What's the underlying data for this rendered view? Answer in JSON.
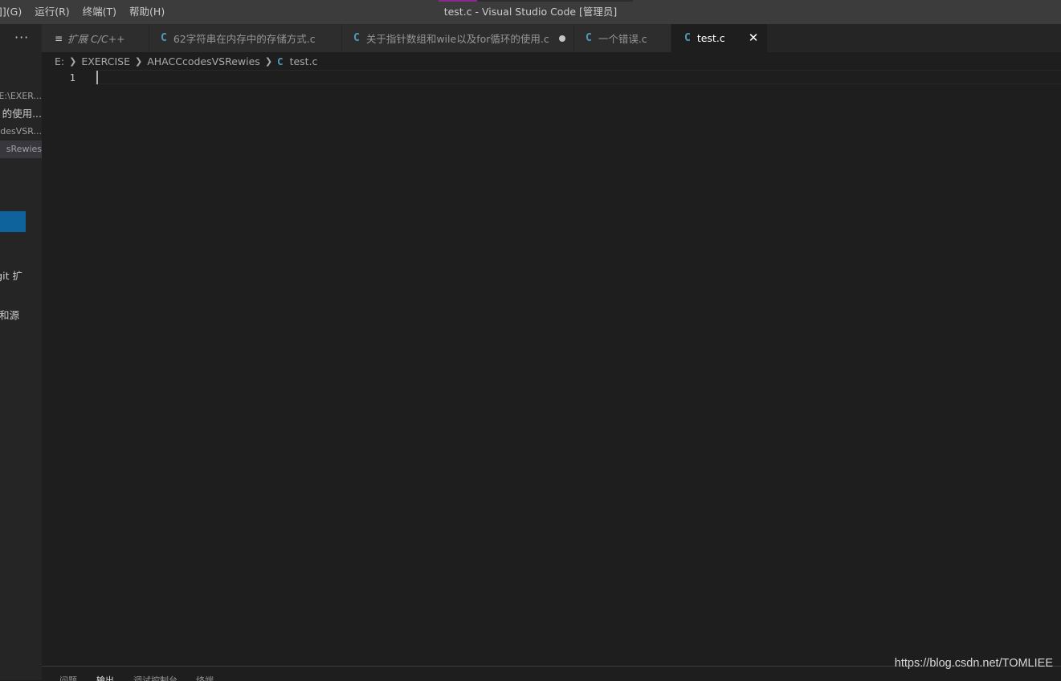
{
  "menu": {
    "items": [
      "]](G)",
      "运行(R)",
      "终端(T)",
      "帮助(H)"
    ]
  },
  "window": {
    "title": "test.c - Visual Studio Code [管理员]"
  },
  "sidebar": {
    "more_label": "···",
    "rows": [
      "E:\\EXER...",
      "的使用...",
      "odesVSR...",
      "sRewies"
    ],
    "texts": [
      "git 扩",
      "和源"
    ]
  },
  "tabs": [
    {
      "icon": "markdown-preview-icon",
      "label": "扩展 C/C++",
      "italic": true
    },
    {
      "icon": "c-file-icon",
      "label": "62字符串在内存中的存储方式.c"
    },
    {
      "icon": "c-file-icon",
      "label": "关于指针数组和wile以及for循环的使用.c",
      "dirty": true
    },
    {
      "icon": "c-file-icon",
      "label": "一个错误.c"
    },
    {
      "icon": "c-file-icon",
      "label": "test.c",
      "active": true,
      "close": "✕"
    }
  ],
  "breadcrumbs": [
    "E:",
    "EXERCISE",
    "AHACCcodesVSRewies",
    "test.c"
  ],
  "editor": {
    "line_numbers": [
      "1"
    ]
  },
  "panel": {
    "tabs": [
      "问题",
      "输出",
      "调试控制台",
      "终端"
    ]
  },
  "watermark": "https://blog.csdn.net/TOMLIEE",
  "colors": {
    "accent": "#0e639c",
    "c_icon": "#519aba",
    "background": "#1e1e1e"
  }
}
